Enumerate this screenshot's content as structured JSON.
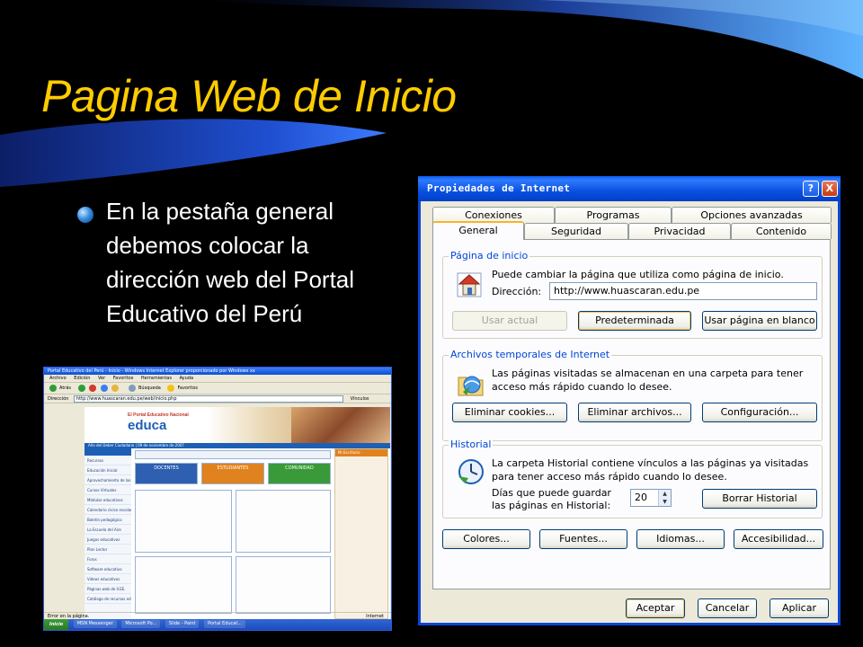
{
  "slide": {
    "title": "Pagina Web de Inicio",
    "bullet": "En la pestaña general debemos colocar la dirección web del Portal Educativo del Perú"
  },
  "browser": {
    "title": "Portal Educativo del Perú - Inicio - Windows Internet Explorer proporcionado por Windows xx",
    "menu": [
      "Archivo",
      "Edición",
      "Ver",
      "Favoritos",
      "Herramientas",
      "Ayuda"
    ],
    "toolbar": [
      "Atrás",
      "Búsqueda",
      "Favoritos"
    ],
    "address_label": "Dirección",
    "address_value": "http://www.huascaran.edu.pe/web/inicio.php",
    "go_label": "Vínculos",
    "logo_small": "El Portal Educativo Nacional",
    "logo_main": "educa",
    "date_bar": "Año del Deber Ciudadano | 09 de noviembre de 2007",
    "left_menu": [
      "Recursos",
      "Educación Inicial",
      "Aprovechamiento de las TIC",
      "Cursos Virtuales",
      "Módulos educativos",
      "Calendario cívico escolar",
      "Boletín pedagógico",
      "La Escuela del Aire",
      "Juegos educativos",
      "Plan Lector",
      "Foros",
      "Software educativo",
      "Videos educativos",
      "Páginas web de II.EE.",
      "Catálogo de recursos educativos"
    ],
    "sections": [
      "DOCENTES",
      "ESTUDIANTES",
      "COMUNIDAD"
    ],
    "right_title": "Mi Escritorio",
    "status": "Error en la página.",
    "internet_label": "Internet",
    "start_label": "Inicio",
    "tasks": [
      "MSN Messenger",
      "Microsoft Po...",
      "Slide - Paint",
      "Portal Educat..."
    ]
  },
  "dialog": {
    "title": "Propiedades de Internet",
    "help": "?",
    "close": "X",
    "tabs_row1": [
      "Conexiones",
      "Programas",
      "Opciones avanzadas"
    ],
    "tabs_row2": [
      "General",
      "Seguridad",
      "Privacidad",
      "Contenido"
    ],
    "homepage": {
      "title": "Página de inicio",
      "description": "Puede cambiar la página que utiliza como página de inicio.",
      "address_label": "Dirección:",
      "address_value": "http://www.huascaran.edu.pe",
      "btn_current": "Usar actual",
      "btn_default": "Predeterminada",
      "btn_blank": "Usar página en blanco"
    },
    "temp_files": {
      "title": "Archivos temporales de Internet",
      "description": "Las páginas visitadas se almacenan en una carpeta para tener acceso más rápido cuando lo desee.",
      "btn_cookies": "Eliminar cookies...",
      "btn_files": "Eliminar archivos...",
      "btn_settings": "Configuración..."
    },
    "history": {
      "title": "Historial",
      "description": "La carpeta Historial contiene vínculos a las páginas ya visitadas para tener acceso más rápido cuando lo desee.",
      "days_label": "Días que puede guardar las páginas en Historial:",
      "days_value": "20",
      "btn_clear": "Borrar Historial"
    },
    "bottom_buttons": {
      "colors": "Colores...",
      "fonts": "Fuentes...",
      "languages": "Idiomas...",
      "accessibility": "Accesibilidad..."
    },
    "footer": {
      "ok": "Aceptar",
      "cancel": "Cancelar",
      "apply": "Aplicar"
    }
  },
  "colors": {
    "title": "#ffcc00",
    "dialog_titlebar": "#0a50e0",
    "group_title": "#0046d5"
  }
}
